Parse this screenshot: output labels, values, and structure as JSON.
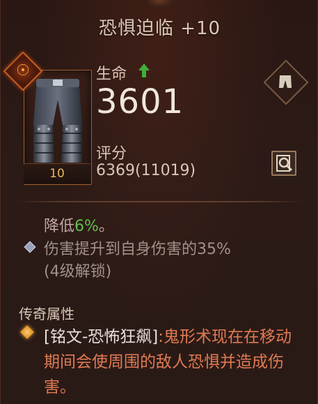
{
  "item": {
    "title": "恐惧迫临 +10",
    "level": "10",
    "primary_stat_label": "生命",
    "primary_stat_value": "3601",
    "score_label": "评分",
    "score_value": "6369(11019)"
  },
  "effects": {
    "reduce_prefix": "降低",
    "reduce_percent": "6%",
    "reduce_suffix": "。",
    "locked_line_1": "伤害提升到自身伤害的35%",
    "locked_line_2": "(4级解锁)"
  },
  "legendary": {
    "heading": "传奇属性",
    "name": "[铭文-恐怖狂飙]",
    "text": ":鬼形术现在在移动期间会使周围的敌人恐惧并造成伤害。"
  },
  "icons": {
    "rune": "rune-icon",
    "stat_up": "up-arrow-icon",
    "slot": "pants-slot-icon",
    "compare": "magnifier-compare-icon",
    "item": "legendary-pants-image",
    "legendary_bullet": "gold-diamond-icon",
    "effect_bullet": "silver-diamond-icon"
  },
  "colors": {
    "background": "#2a1814",
    "title_text": "#d9c7b7",
    "legendary_text": "#e07a52",
    "level_text": "#e6b85b",
    "increase_green": "#61c04a"
  }
}
